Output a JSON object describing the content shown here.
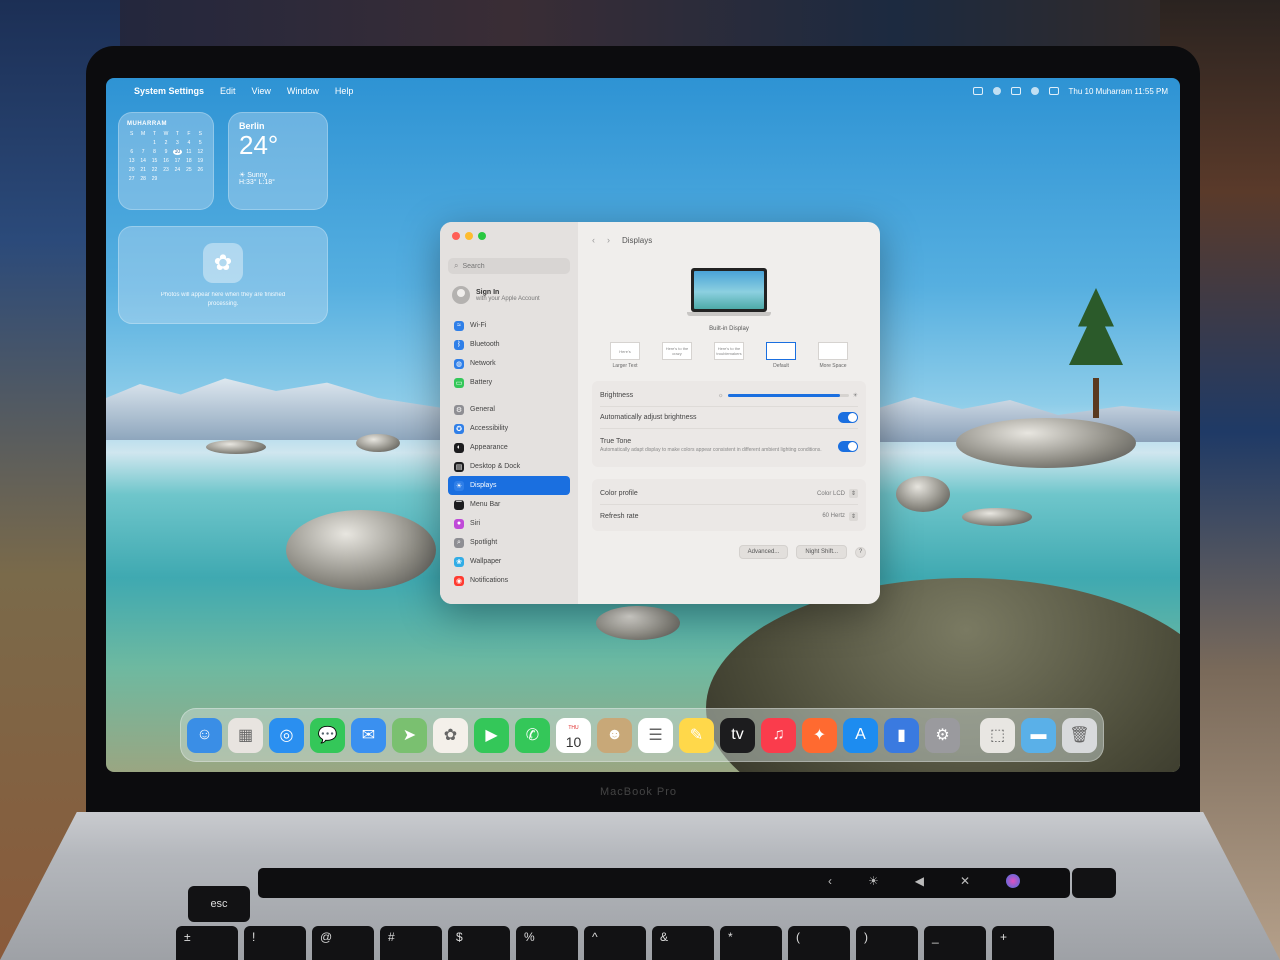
{
  "menubar": {
    "app_name": "System Settings",
    "items": [
      "Edit",
      "View",
      "Window",
      "Help"
    ],
    "clock": "Thu 10 Muharram  11:55 PM"
  },
  "widgets": {
    "calendar": {
      "month": "MUHARRAM",
      "weekdays": [
        "S",
        "M",
        "T",
        "W",
        "T",
        "F",
        "S"
      ],
      "days": [
        "",
        "",
        "1",
        "2",
        "3",
        "4",
        "5",
        "6",
        "7",
        "8",
        "9",
        "10",
        "11",
        "12",
        "13",
        "14",
        "15",
        "16",
        "17",
        "18",
        "19",
        "20",
        "21",
        "22",
        "23",
        "24",
        "25",
        "26",
        "27",
        "28",
        "29"
      ],
      "today": "10"
    },
    "weather": {
      "city": "Berlin",
      "temp": "24°",
      "condition": "Sunny",
      "hilo": "H:33° L:18°"
    },
    "photos": {
      "message": "Photos will appear here when they are finished processing."
    }
  },
  "settings": {
    "search_placeholder": "Search",
    "signin": {
      "title": "Sign In",
      "subtitle": "with your Apple Account"
    },
    "sidebar": [
      {
        "label": "Wi-Fi",
        "icon": "wifi-icon",
        "color": "#2f7fe8"
      },
      {
        "label": "Bluetooth",
        "icon": "bluetooth-icon",
        "color": "#2f7fe8"
      },
      {
        "label": "Network",
        "icon": "globe-icon",
        "color": "#2f7fe8"
      },
      {
        "label": "Battery",
        "icon": "battery-icon",
        "color": "#34c759"
      },
      {
        "label": "General",
        "icon": "gear-icon",
        "color": "#8e8e93"
      },
      {
        "label": "Accessibility",
        "icon": "accessibility-icon",
        "color": "#2f7fe8"
      },
      {
        "label": "Appearance",
        "icon": "appearance-icon",
        "color": "#1c1c1e"
      },
      {
        "label": "Desktop & Dock",
        "icon": "dock-icon",
        "color": "#1c1c1e"
      },
      {
        "label": "Displays",
        "icon": "sun-icon",
        "color": "#2f7fe8"
      },
      {
        "label": "Menu Bar",
        "icon": "menubar-icon",
        "color": "#1c1c1e"
      },
      {
        "label": "Siri",
        "icon": "siri-icon",
        "color": "#c04ad8"
      },
      {
        "label": "Spotlight",
        "icon": "spotlight-icon",
        "color": "#8e8e93"
      },
      {
        "label": "Wallpaper",
        "icon": "wallpaper-icon",
        "color": "#32ade6"
      },
      {
        "label": "Notifications",
        "icon": "bell-icon",
        "color": "#ff3b30"
      }
    ],
    "active": "Displays",
    "page_title": "Displays",
    "display_name": "Built-in Display",
    "resolutions": [
      {
        "thumb": "Here's",
        "label": "Larger Text"
      },
      {
        "thumb": "Here's to the crazy",
        "label": ""
      },
      {
        "thumb": "Here's to the troublemakers",
        "label": ""
      },
      {
        "thumb": "",
        "label": "Default"
      },
      {
        "thumb": "",
        "label": "More Space"
      }
    ],
    "selected_resolution": "Default",
    "brightness_label": "Brightness",
    "brightness_value": 0.93,
    "auto_brightness_label": "Automatically adjust brightness",
    "auto_brightness_on": true,
    "true_tone_label": "True Tone",
    "true_tone_desc": "Automatically adapt display to make colors appear consistent in different ambient lighting conditions.",
    "true_tone_on": true,
    "color_profile_label": "Color profile",
    "color_profile_value": "Color LCD",
    "refresh_rate_label": "Refresh rate",
    "refresh_rate_value": "60 Hertz",
    "advanced_button": "Advanced...",
    "night_shift_button": "Night Shift...",
    "help_button": "?"
  },
  "dock": {
    "icons": [
      {
        "name": "finder-icon",
        "color": "#3a8ee6",
        "glyph": "☺"
      },
      {
        "name": "launchpad-icon",
        "color": "#e8e4e0",
        "glyph": "▦"
      },
      {
        "name": "safari-icon",
        "color": "#2a8ff0",
        "glyph": "◎"
      },
      {
        "name": "messages-icon",
        "color": "#34c759",
        "glyph": "💬"
      },
      {
        "name": "mail-icon",
        "color": "#3a90f0",
        "glyph": "✉"
      },
      {
        "name": "maps-icon",
        "color": "#7ac070",
        "glyph": "➤"
      },
      {
        "name": "photos-icon",
        "color": "#f4f0ea",
        "glyph": "✿"
      },
      {
        "name": "facetime-icon",
        "color": "#34c759",
        "glyph": "▶"
      },
      {
        "name": "phone-icon",
        "color": "#34c759",
        "glyph": "✆"
      },
      {
        "name": "calendar-icon",
        "color": "#ffffff",
        "glyph": "10"
      },
      {
        "name": "contacts-icon",
        "color": "#c8a878",
        "glyph": "☻"
      },
      {
        "name": "reminders-icon",
        "color": "#ffffff",
        "glyph": "☰"
      },
      {
        "name": "notes-icon",
        "color": "#ffd84a",
        "glyph": "✎"
      },
      {
        "name": "tv-icon",
        "color": "#1c1c1e",
        "glyph": "tv"
      },
      {
        "name": "music-icon",
        "color": "#fa3c4c",
        "glyph": "♫"
      },
      {
        "name": "podcasts-icon",
        "color": "#ff6a30",
        "glyph": "✦"
      },
      {
        "name": "appstore-icon",
        "color": "#1d8cf0",
        "glyph": "A"
      },
      {
        "name": "xcode-icon",
        "color": "#3a7ae0",
        "glyph": "▮"
      },
      {
        "name": "settings-icon",
        "color": "#9a9a9e",
        "glyph": "⚙"
      }
    ],
    "after_sep": [
      {
        "name": "installer-icon",
        "color": "#e8e6e2",
        "glyph": "⬚"
      },
      {
        "name": "downloads-folder-icon",
        "color": "#5ab0e8",
        "glyph": "▬"
      },
      {
        "name": "trash-icon",
        "color": "#d8dadc",
        "glyph": "🗑"
      }
    ]
  },
  "hardware": {
    "brand": "MacBook Pro",
    "esc": "esc",
    "keys": [
      "±",
      "!",
      "@",
      "#",
      "$",
      "%",
      "^",
      "&",
      "*",
      "(",
      ")",
      "_",
      "+"
    ]
  }
}
